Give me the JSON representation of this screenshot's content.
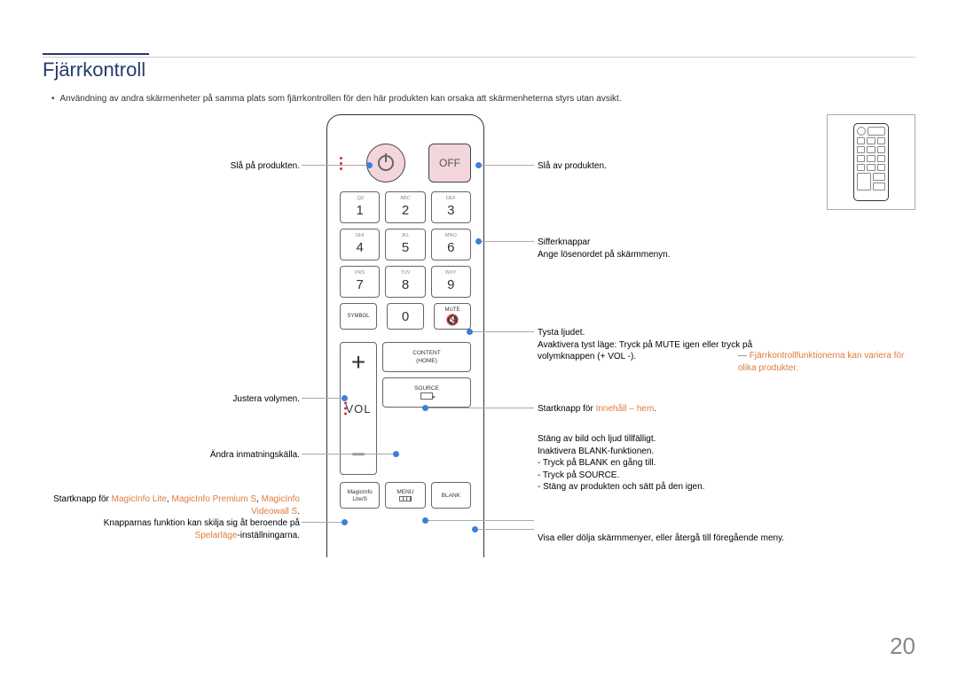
{
  "title": "Fjärrkontroll",
  "intro": "Användning av andra skärmenheter på samma plats som fjärrkontrollen för den här produkten kan orsaka att skärmenheterna styrs utan avsikt.",
  "footnote": "Fjärrkontrollfunktionerna kan variera för olika produkter.",
  "page_number": "20",
  "remote": {
    "off": "OFF",
    "vol": "VOL",
    "keys": [
      {
        "n": "1",
        "s": ".QZ"
      },
      {
        "n": "2",
        "s": "ABC"
      },
      {
        "n": "3",
        "s": "DEF"
      },
      {
        "n": "4",
        "s": "GHI"
      },
      {
        "n": "5",
        "s": "JKL"
      },
      {
        "n": "6",
        "s": "MNO"
      },
      {
        "n": "7",
        "s": "PRS"
      },
      {
        "n": "8",
        "s": "TUV"
      },
      {
        "n": "9",
        "s": "WXY"
      }
    ],
    "zero": "0",
    "symbol": "SYMBOL",
    "mute": "MUTE",
    "content_home1": "CONTENT",
    "content_home2": "(HOME)",
    "source": "SOURCE",
    "magicinfo1": "MagicInfo",
    "magicinfo2": "Lite/S",
    "menu": "MENU",
    "blank": "BLANK"
  },
  "labels": {
    "power_on": "Slå på produkten.",
    "adjust_vol": "Justera volymen.",
    "change_src": "Ändra inmatningskälla.",
    "magicinfo_a": "Startknapp för ",
    "magicinfo_b": "MagicInfo Lite",
    "magicinfo_c": ", ",
    "magicinfo_d": "MagicInfo Premium S",
    "magicinfo_e": ", ",
    "magicinfo_f": "MagicInfo Videowall S",
    "magicinfo_g": ".",
    "magicinfo_h": "Knapparnas funktion kan skilja sig åt beroende på",
    "magicinfo_i": "Spelarläge",
    "magicinfo_j": "-inställningarna.",
    "power_off": "Slå av produkten.",
    "num_a": "Sifferknappar",
    "num_b": "Ange lösenordet på skärmmenyn.",
    "mute_a": "Tysta ljudet.",
    "mute_b": "Avaktivera tyst läge: Tryck på MUTE igen eller tryck på volymknappen (+ VOL -).",
    "home_a": "Startknapp för ",
    "home_b": "Innehåll – hem",
    "home_c": ".",
    "blank_a": "Stäng av  bild och ljud tillfälligt.",
    "blank_b": "Inaktivera BLANK-funktionen.",
    "blank_c": "- Tryck på BLANK en gång till.",
    "blank_d": "- Tryck på SOURCE.",
    "blank_e": "- Stäng av  produkten och sätt på den igen.",
    "menu_a": "Visa eller dölja skärmmenyer, eller återgå till föregående meny."
  }
}
